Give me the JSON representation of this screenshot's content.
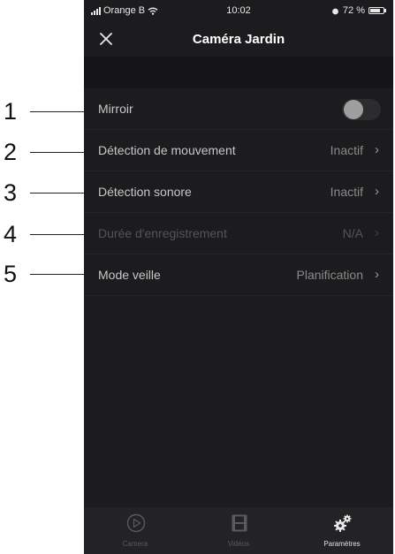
{
  "status_bar": {
    "carrier": "Orange B",
    "time": "10:02",
    "battery": "72 %"
  },
  "header": {
    "title": "Caméra Jardin"
  },
  "settings": [
    {
      "label": "Mirroir",
      "value": "",
      "type": "toggle",
      "enabled": true
    },
    {
      "label": "Détection de mouvement",
      "value": "Inactif",
      "type": "link",
      "enabled": true
    },
    {
      "label": "Détection sonore",
      "value": "Inactif",
      "type": "link",
      "enabled": true
    },
    {
      "label": "Durée d'enregistrement",
      "value": "N/A",
      "type": "link",
      "enabled": false
    },
    {
      "label": "Mode veille",
      "value": "Planification",
      "type": "link",
      "enabled": true
    }
  ],
  "tabs": [
    {
      "label": "Camera",
      "icon": "play-circle-icon",
      "active": false
    },
    {
      "label": "Vidéos",
      "icon": "film-icon",
      "active": false
    },
    {
      "label": "Paramètres",
      "icon": "gears-icon",
      "active": true
    }
  ],
  "callouts": [
    "1",
    "2",
    "3",
    "4",
    "5"
  ]
}
